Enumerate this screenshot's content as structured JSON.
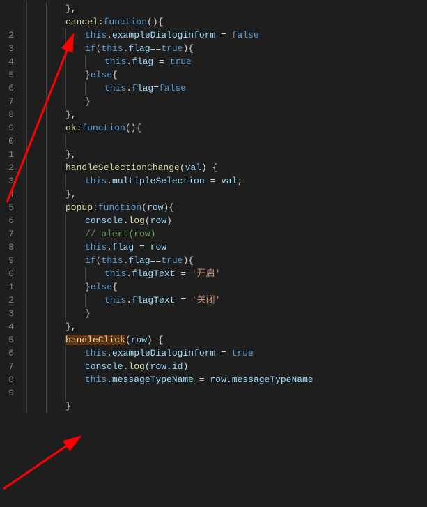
{
  "lineNumbers": [
    "",
    "",
    "2",
    "3",
    "4",
    "5",
    "6",
    "7",
    "8",
    "9",
    "0",
    "1",
    "2",
    "3",
    "4",
    "5",
    "6",
    "7",
    "8",
    "9",
    "0",
    "1",
    "2",
    "3",
    "4",
    "5",
    "6",
    "7",
    "8",
    "9",
    "",
    ""
  ],
  "code": {
    "l0": {
      "indent": 2,
      "t": [
        {
          "c": "punc",
          "s": "},"
        }
      ]
    },
    "l1": {
      "indent": 2,
      "t": [
        {
          "c": "fn",
          "s": "cancel"
        },
        {
          "c": "punc",
          "s": ":"
        },
        {
          "c": "kw",
          "s": "function"
        },
        {
          "c": "punc",
          "s": "(){"
        }
      ]
    },
    "l2": {
      "indent": 3,
      "t": [
        {
          "c": "kw",
          "s": "this"
        },
        {
          "c": "punc",
          "s": "."
        },
        {
          "c": "prop",
          "s": "exampleDialoginform"
        },
        {
          "c": "punc",
          "s": " = "
        },
        {
          "c": "bool",
          "s": "false"
        }
      ]
    },
    "l3": {
      "indent": 3,
      "t": [
        {
          "c": "kw",
          "s": "if"
        },
        {
          "c": "punc",
          "s": "("
        },
        {
          "c": "kw",
          "s": "this"
        },
        {
          "c": "punc",
          "s": "."
        },
        {
          "c": "prop",
          "s": "flag"
        },
        {
          "c": "punc",
          "s": "=="
        },
        {
          "c": "bool",
          "s": "true"
        },
        {
          "c": "punc",
          "s": "){"
        }
      ]
    },
    "l4": {
      "indent": 4,
      "t": [
        {
          "c": "kw",
          "s": "this"
        },
        {
          "c": "punc",
          "s": "."
        },
        {
          "c": "prop",
          "s": "flag"
        },
        {
          "c": "punc",
          "s": " = "
        },
        {
          "c": "bool",
          "s": "true"
        }
      ]
    },
    "l5": {
      "indent": 3,
      "t": [
        {
          "c": "punc",
          "s": "}"
        },
        {
          "c": "kw",
          "s": "else"
        },
        {
          "c": "punc",
          "s": "{"
        }
      ]
    },
    "l6": {
      "indent": 4,
      "t": [
        {
          "c": "kw",
          "s": "this"
        },
        {
          "c": "punc",
          "s": "."
        },
        {
          "c": "prop",
          "s": "flag"
        },
        {
          "c": "punc",
          "s": "="
        },
        {
          "c": "bool",
          "s": "false"
        }
      ]
    },
    "l7": {
      "indent": 3,
      "t": [
        {
          "c": "punc",
          "s": "}"
        }
      ]
    },
    "l8": {
      "indent": 2,
      "t": [
        {
          "c": "punc",
          "s": "},"
        }
      ]
    },
    "l9": {
      "indent": 2,
      "t": [
        {
          "c": "fn",
          "s": "ok"
        },
        {
          "c": "punc",
          "s": ":"
        },
        {
          "c": "kw",
          "s": "function"
        },
        {
          "c": "punc",
          "s": "(){"
        }
      ]
    },
    "l10": {
      "indent": 3,
      "t": []
    },
    "l11": {
      "indent": 2,
      "t": [
        {
          "c": "punc",
          "s": "},"
        }
      ]
    },
    "l12": {
      "indent": 2,
      "t": [
        {
          "c": "fn",
          "s": "handleSelectionChange"
        },
        {
          "c": "punc",
          "s": "("
        },
        {
          "c": "prop",
          "s": "val"
        },
        {
          "c": "punc",
          "s": ") {"
        }
      ]
    },
    "l13": {
      "indent": 3,
      "t": [
        {
          "c": "kw",
          "s": "this"
        },
        {
          "c": "punc",
          "s": "."
        },
        {
          "c": "prop",
          "s": "multipleSelection"
        },
        {
          "c": "punc",
          "s": " = "
        },
        {
          "c": "prop",
          "s": "val"
        },
        {
          "c": "punc",
          "s": ";"
        }
      ]
    },
    "l14": {
      "indent": 2,
      "t": [
        {
          "c": "punc",
          "s": "},"
        }
      ]
    },
    "l15": {
      "indent": 2,
      "t": [
        {
          "c": "fn",
          "s": "popup"
        },
        {
          "c": "punc",
          "s": ":"
        },
        {
          "c": "kw",
          "s": "function"
        },
        {
          "c": "punc",
          "s": "("
        },
        {
          "c": "prop",
          "s": "row"
        },
        {
          "c": "punc",
          "s": "){"
        }
      ]
    },
    "l16": {
      "indent": 3,
      "t": [
        {
          "c": "prop",
          "s": "console"
        },
        {
          "c": "punc",
          "s": "."
        },
        {
          "c": "fn",
          "s": "log"
        },
        {
          "c": "punc",
          "s": "("
        },
        {
          "c": "prop",
          "s": "row"
        },
        {
          "c": "punc",
          "s": ")"
        }
      ]
    },
    "l17": {
      "indent": 3,
      "t": [
        {
          "c": "cmnt",
          "s": "// alert(row)"
        }
      ]
    },
    "l18": {
      "indent": 3,
      "t": [
        {
          "c": "kw",
          "s": "this"
        },
        {
          "c": "punc",
          "s": "."
        },
        {
          "c": "prop",
          "s": "flag"
        },
        {
          "c": "punc",
          "s": " = "
        },
        {
          "c": "prop",
          "s": "row"
        }
      ]
    },
    "l19": {
      "indent": 3,
      "t": [
        {
          "c": "kw",
          "s": "if"
        },
        {
          "c": "punc",
          "s": "("
        },
        {
          "c": "kw",
          "s": "this"
        },
        {
          "c": "punc",
          "s": "."
        },
        {
          "c": "prop",
          "s": "flag"
        },
        {
          "c": "punc",
          "s": "=="
        },
        {
          "c": "bool",
          "s": "true"
        },
        {
          "c": "punc",
          "s": "){"
        }
      ]
    },
    "l20": {
      "indent": 4,
      "t": [
        {
          "c": "kw",
          "s": "this"
        },
        {
          "c": "punc",
          "s": "."
        },
        {
          "c": "prop",
          "s": "flagText"
        },
        {
          "c": "punc",
          "s": " = "
        },
        {
          "c": "str",
          "s": "'开启'"
        }
      ]
    },
    "l21": {
      "indent": 3,
      "t": [
        {
          "c": "punc",
          "s": "}"
        },
        {
          "c": "kw",
          "s": "else"
        },
        {
          "c": "punc",
          "s": "{"
        }
      ]
    },
    "l22": {
      "indent": 4,
      "t": [
        {
          "c": "kw",
          "s": "this"
        },
        {
          "c": "punc",
          "s": "."
        },
        {
          "c": "prop",
          "s": "flagText"
        },
        {
          "c": "punc",
          "s": " = "
        },
        {
          "c": "str",
          "s": "'关闭'"
        }
      ]
    },
    "l23": {
      "indent": 3,
      "t": [
        {
          "c": "punc",
          "s": "}"
        }
      ]
    },
    "l24": {
      "indent": 2,
      "t": [
        {
          "c": "punc",
          "s": "},"
        }
      ]
    },
    "l25": {
      "indent": 2,
      "t": [
        {
          "c": "fn hl",
          "s": "handleClick"
        },
        {
          "c": "punc",
          "s": "("
        },
        {
          "c": "prop",
          "s": "row"
        },
        {
          "c": "punc",
          "s": ") {"
        }
      ]
    },
    "l26": {
      "indent": 3,
      "t": [
        {
          "c": "kw",
          "s": "this"
        },
        {
          "c": "punc",
          "s": "."
        },
        {
          "c": "prop",
          "s": "exampleDialoginform"
        },
        {
          "c": "punc",
          "s": " = "
        },
        {
          "c": "bool",
          "s": "true"
        }
      ]
    },
    "l27": {
      "indent": 3,
      "t": [
        {
          "c": "prop",
          "s": "console"
        },
        {
          "c": "punc",
          "s": "."
        },
        {
          "c": "fn",
          "s": "log"
        },
        {
          "c": "punc",
          "s": "("
        },
        {
          "c": "prop",
          "s": "row"
        },
        {
          "c": "punc",
          "s": "."
        },
        {
          "c": "prop",
          "s": "id"
        },
        {
          "c": "punc",
          "s": ")"
        }
      ]
    },
    "l28": {
      "indent": 3,
      "t": [
        {
          "c": "kw",
          "s": "this"
        },
        {
          "c": "punc",
          "s": "."
        },
        {
          "c": "prop",
          "s": "messageTypeName"
        },
        {
          "c": "punc",
          "s": " = "
        },
        {
          "c": "prop",
          "s": "row"
        },
        {
          "c": "punc",
          "s": "."
        },
        {
          "c": "prop",
          "s": "messageTypeName"
        }
      ]
    },
    "l29": {
      "indent": 3,
      "t": []
    },
    "l30": {
      "indent": 2,
      "t": [
        {
          "c": "punc",
          "s": "}"
        }
      ]
    }
  },
  "colors": {
    "arrow": "#ff0000"
  }
}
